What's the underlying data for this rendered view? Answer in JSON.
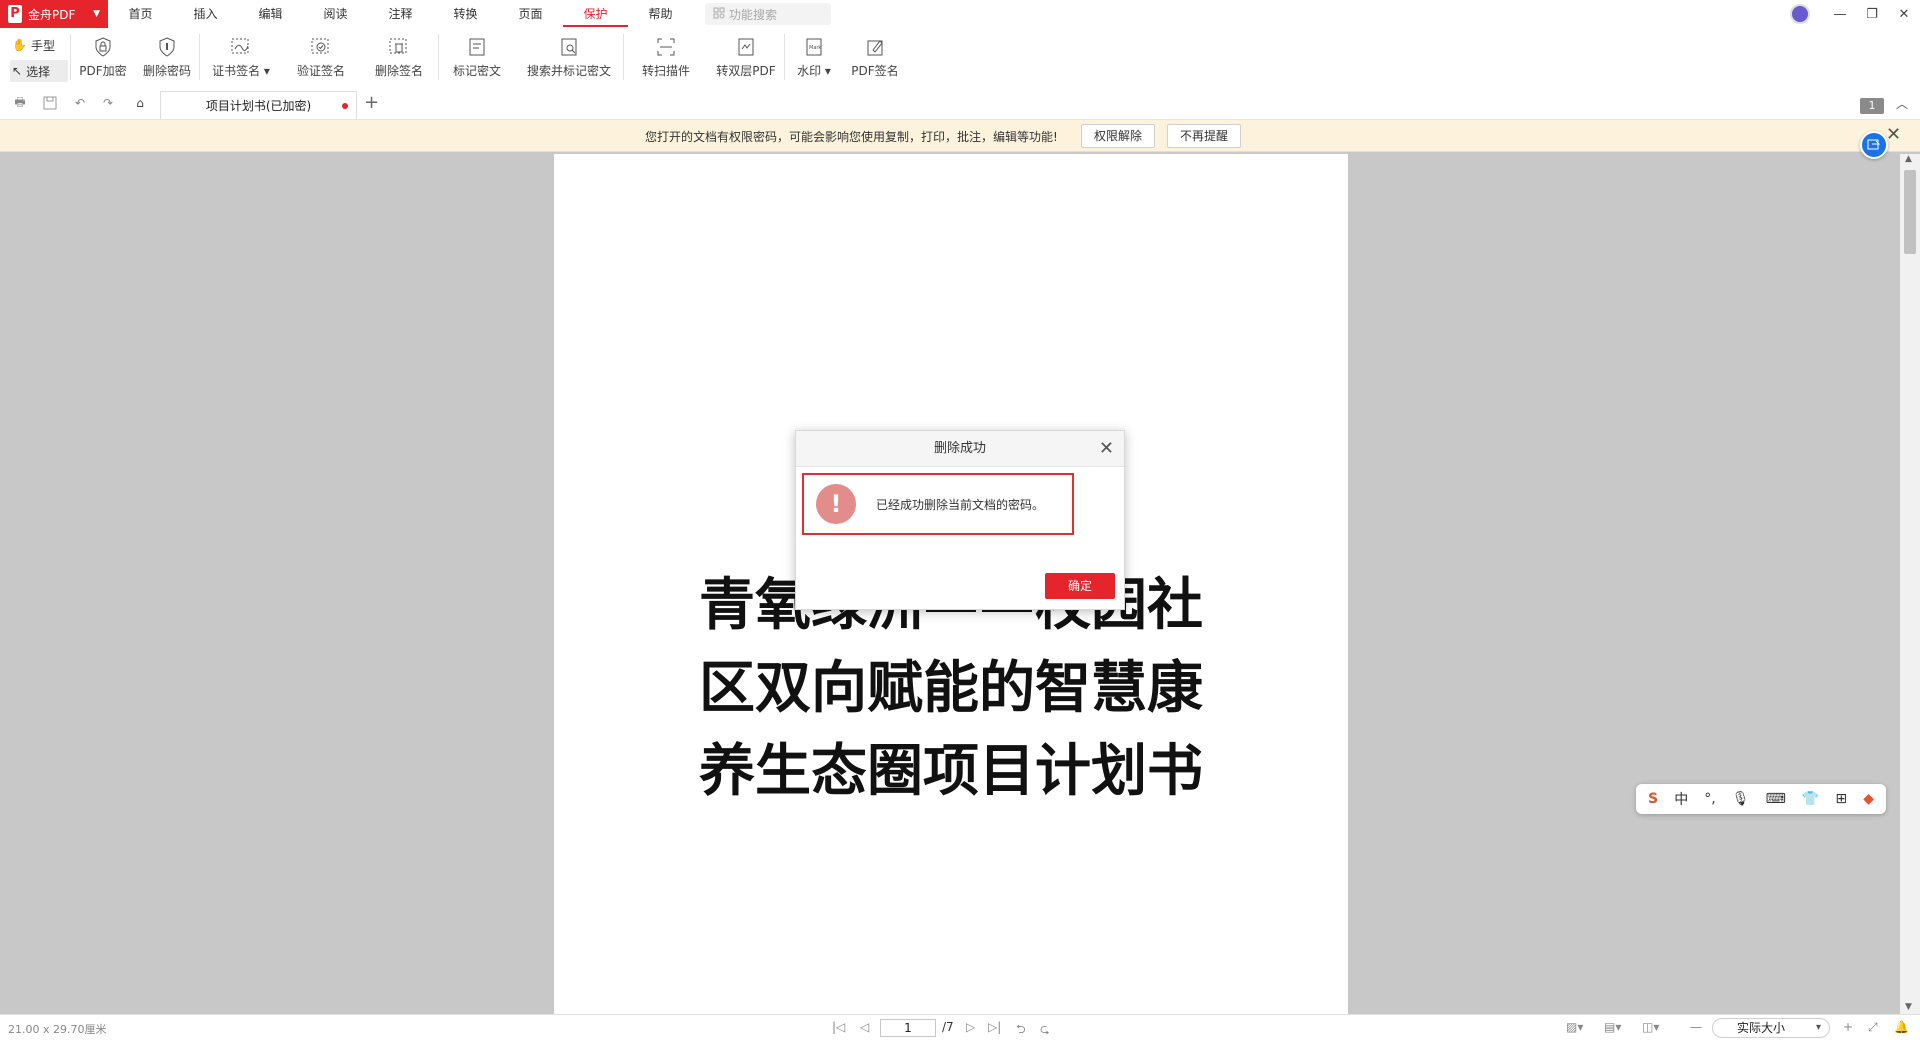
{
  "app": {
    "name": "金舟PDF",
    "logo_letter": "P"
  },
  "menu": {
    "items": [
      "首页",
      "插入",
      "编辑",
      "阅读",
      "注释",
      "转换",
      "页面",
      "保护",
      "帮助"
    ],
    "active": "保护",
    "search_placeholder": "功能搜索"
  },
  "ribbon": {
    "hand": "手型",
    "select": "选择",
    "tools": {
      "pdf_encrypt": "PDF加密",
      "remove_password": "删除密码",
      "cert_sign": "证书签名",
      "verify_sign": "验证签名",
      "delete_sign": "删除签名",
      "mark_redact": "标记密文",
      "search_redact": "搜索并标记密文",
      "convert_scan": "转扫描件",
      "dual_layer": "转双层PDF",
      "watermark": "水印",
      "pdf_sign": "PDF签名"
    }
  },
  "tab": {
    "title": "项目计划书(已加密)",
    "page_badge": "1"
  },
  "notice": {
    "text": "您打开的文档有权限密码，可能会影响您使用复制，打印，批注，编辑等功能!",
    "unlock_label": "权限解除",
    "dismiss_label": "不再提醒"
  },
  "document": {
    "title_lines": [
      "青氧绿洲——校园社",
      "区双向赋能的智慧康",
      "养生态圈项目计划书"
    ]
  },
  "modal": {
    "title": "删除成功",
    "message": "已经成功删除当前文档的密码。",
    "ok_label": "确定"
  },
  "ime": {
    "mode": "中"
  },
  "status": {
    "page_size": "21.00 x 29.70厘米",
    "current_page": "1",
    "total_pages": "/7",
    "zoom": "实际大小"
  },
  "colors": {
    "accent": "#e5242b",
    "notice_bg": "#fdf3dc",
    "canvas": "#c8c8c8"
  }
}
